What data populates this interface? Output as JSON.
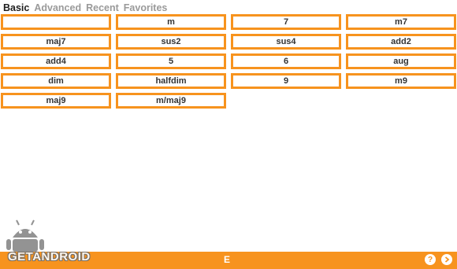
{
  "tabs": [
    {
      "label": "Basic",
      "active": true
    },
    {
      "label": "Advanced",
      "active": false
    },
    {
      "label": "Recent",
      "active": false
    },
    {
      "label": "Favorites",
      "active": false
    }
  ],
  "chords": [
    "",
    "m",
    "7",
    "m7",
    "maj7",
    "sus2",
    "sus4",
    "add2",
    "add4",
    "5",
    "6",
    "aug",
    "dim",
    "halfdim",
    "9",
    "m9",
    "maj9",
    "m/maj9"
  ],
  "bottom_bar": {
    "root_note": "E",
    "help_icon": "question-icon",
    "next_icon": "chevron-right-icon"
  },
  "watermark": {
    "text": "GETANDROID",
    "icon": "android-robot-icon"
  },
  "colors": {
    "accent": "#f7931e",
    "tab_active": "#1e1e1e",
    "tab_inactive": "#9a9a9a"
  }
}
